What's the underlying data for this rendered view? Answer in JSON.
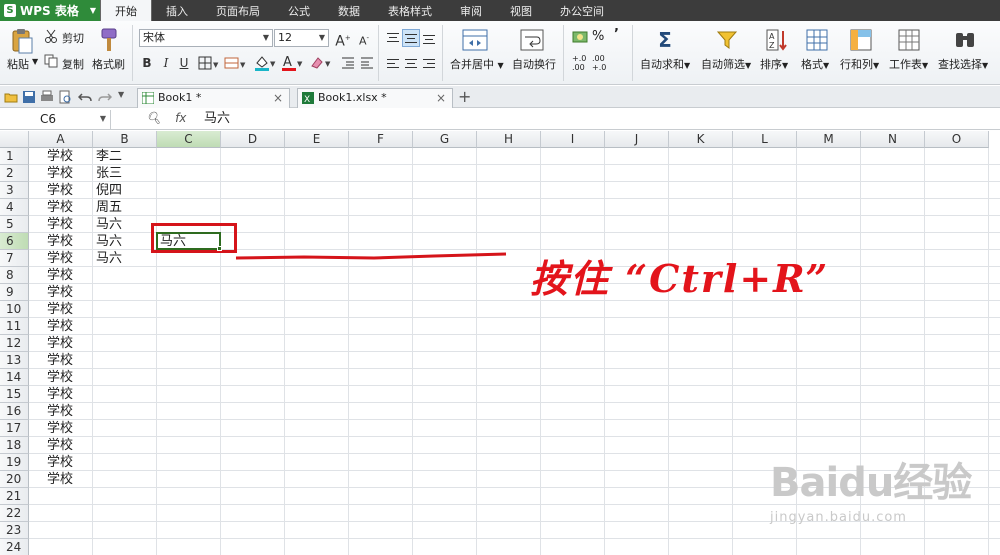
{
  "app": {
    "title": "WPS 表格",
    "logo_letter": "S",
    "menu": [
      "开始",
      "插入",
      "页面布局",
      "公式",
      "数据",
      "表格样式",
      "审阅",
      "视图",
      "办公空间"
    ],
    "active_menu": "开始"
  },
  "ribbon": {
    "paste": "粘贴",
    "cut": "剪切",
    "copy": "复制",
    "format_painter": "格式刷",
    "font_name": "宋体",
    "font_size": "12",
    "bold": "B",
    "italic": "I",
    "underline": "U",
    "font_grow": "A",
    "font_shrink": "A",
    "merge_center": "合并居中",
    "wrap_text": "自动换行",
    "percent": "%",
    "comma": "’",
    "inc_decimal": "+0\n.00",
    "dec_decimal": ".00\n+.0",
    "autosum": "自动求和",
    "autofilter": "自动筛选",
    "sort": "排序",
    "format": "格式",
    "rows_cols": "行和列",
    "worksheet": "工作表",
    "find_select": "查找选择"
  },
  "tabs": [
    {
      "label": "Book1 *",
      "type": "wps"
    },
    {
      "label": "Book1.xlsx *",
      "type": "xlsx"
    }
  ],
  "formula_bar": {
    "name_box": "C6",
    "fx_label": "fx",
    "value": "马六"
  },
  "grid": {
    "columns": [
      "A",
      "B",
      "C",
      "D",
      "E",
      "F",
      "G",
      "H",
      "I",
      "J",
      "K",
      "L",
      "M",
      "N",
      "O"
    ],
    "rows": [
      "1",
      "2",
      "3",
      "4",
      "5",
      "6",
      "7",
      "8",
      "9",
      "10",
      "11",
      "12",
      "13",
      "14",
      "15",
      "16",
      "17",
      "18",
      "19",
      "20",
      "21",
      "22",
      "23",
      "24"
    ],
    "selected_column": "C",
    "selected_row": "6",
    "col_a": [
      "学校",
      "学校",
      "学校",
      "学校",
      "学校",
      "学校",
      "学校",
      "学校",
      "学校",
      "学校",
      "学校",
      "学校",
      "学校",
      "学校",
      "学校",
      "学校",
      "学校",
      "学校",
      "学校",
      "学校"
    ],
    "col_b": [
      "李二",
      "张三",
      "倪四",
      "周五",
      "马六",
      "马六",
      "马六"
    ],
    "c6": "马六"
  },
  "annotation": {
    "text": "按住 “Ctrl+R”",
    "color": "#e3141b"
  },
  "watermark": {
    "brand": "Baidu经验",
    "url": "jingyan.baidu.com"
  },
  "colors": {
    "app_green": "#2f8b3a",
    "selection_green": "#2e6b1f",
    "highlight_red": "#d5141a"
  }
}
